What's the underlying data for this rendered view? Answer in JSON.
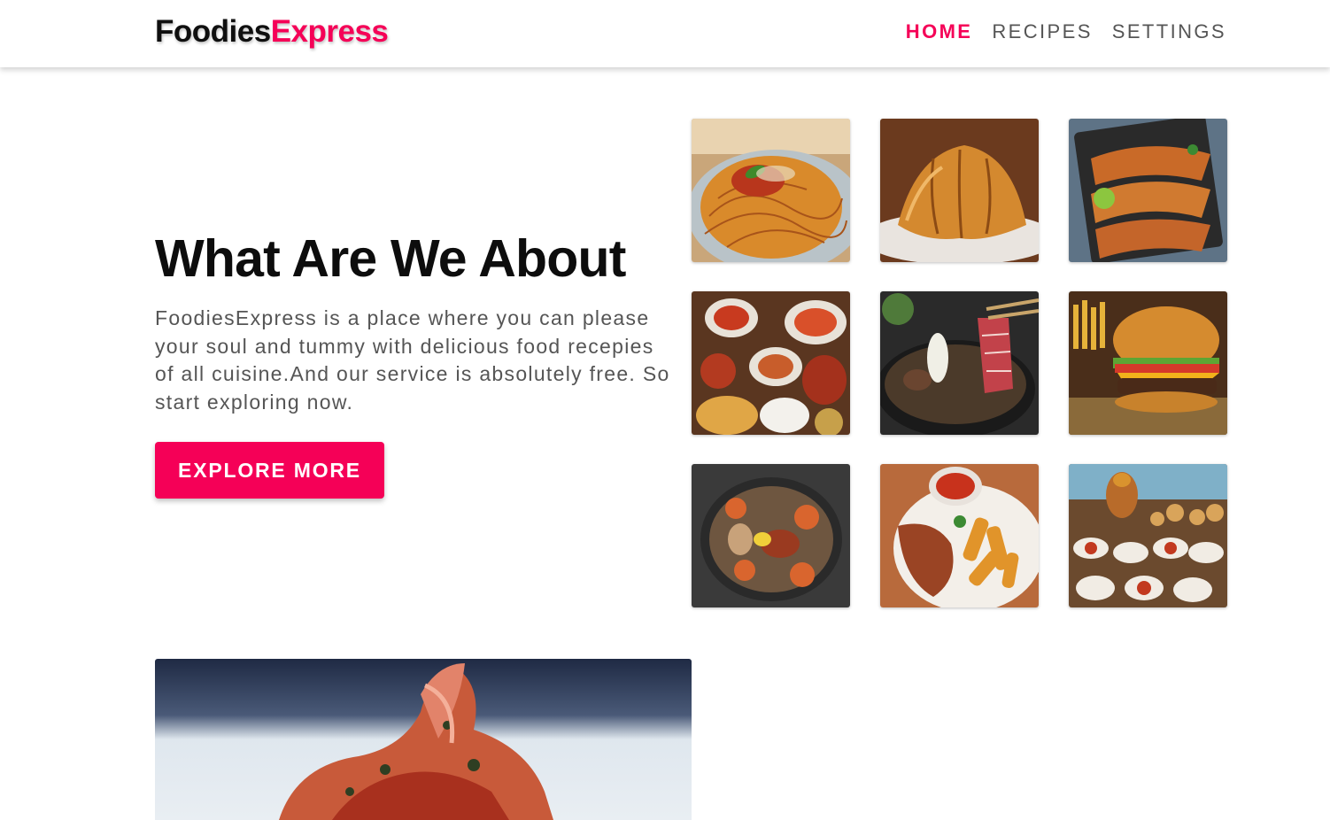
{
  "header": {
    "logo_part1": "Foodies",
    "logo_part2": "Express",
    "nav": [
      {
        "label": "HOME",
        "active": true
      },
      {
        "label": "RECIPES",
        "active": false
      },
      {
        "label": "SETTINGS",
        "active": false
      }
    ]
  },
  "hero": {
    "title": "What Are We About",
    "text": "FoodiesExpress is a place where you can please your soul and tummy with delicious food recepies of all cuisine.And our service is absolutely free. So start exploring now.",
    "button_label": "EXPLORE MORE"
  },
  "colors": {
    "accent": "#f50057",
    "text_dark": "#0d0d0d",
    "text_muted": "#555555"
  }
}
